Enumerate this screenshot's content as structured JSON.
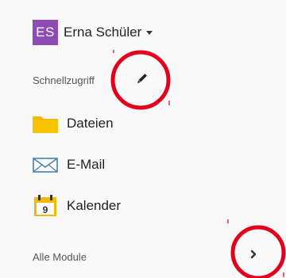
{
  "user": {
    "initials": "ES",
    "name": "Erna Schüler"
  },
  "quick_access": {
    "label": "Schnellzugriff",
    "items": [
      {
        "label": "Dateien",
        "icon": "folder-icon"
      },
      {
        "label": "E-Mail",
        "icon": "mail-icon"
      },
      {
        "label": "Kalender",
        "icon": "calendar-icon",
        "day": "9"
      }
    ]
  },
  "all_modules": {
    "label": "Alle Module"
  },
  "colors": {
    "avatar": "#8e4bb4",
    "folder": "#f5b800",
    "annotation": "#e3001b",
    "mail": "#4a7fb0"
  }
}
